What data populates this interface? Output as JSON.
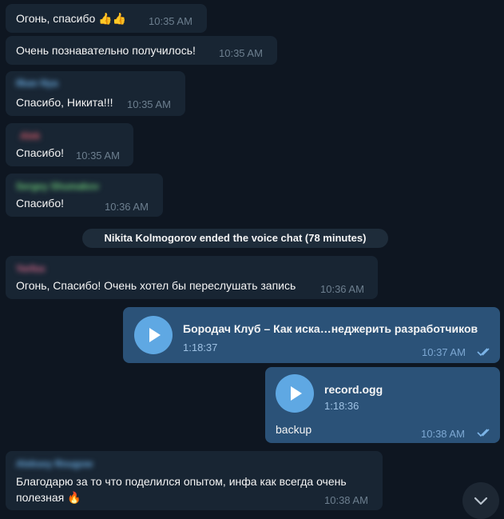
{
  "messages": [
    {
      "text": "Огонь, спасибо 👍👍",
      "time": "10:35 AM"
    },
    {
      "text": "Очень познавательно получилось!",
      "time": "10:35 AM"
    },
    {
      "sender": "Ilkan Nya",
      "sender_color": "#6fb2e8",
      "text": "Спасибо, Никита!!!",
      "time": "10:35 AM"
    },
    {
      "sender": "Alek",
      "sender_color": "#e05f6c",
      "text": "Спасибо!",
      "time": "10:35 AM"
    },
    {
      "sender": "Sergey Shumakov",
      "sender_color": "#6fcf7a",
      "text": "Спасибо!",
      "time": "10:36 AM"
    },
    {
      "sender": "Yerfox",
      "sender_color": "#e06c8f",
      "text": "Огонь, Спасибо! Очень хотел бы переслушать запись",
      "time": "10:36 AM"
    },
    {
      "sender": "Aleksey Rnugow",
      "sender_color": "#6fb2e8",
      "text_line1": "Благодарю за то что поделился опытом, инфа как всегда очень",
      "text_line2": "полезная 🔥",
      "time": "10:38 AM"
    }
  ],
  "service_message": "Nikita Kolmogorov ended the voice chat (78 minutes)",
  "audio1": {
    "title": "Бородач Клуб – Как иска…неджерить разработчиков",
    "duration": "1:18:37",
    "time": "10:37 AM"
  },
  "audio2": {
    "title": "record.ogg",
    "duration": "1:18:36",
    "caption": "backup",
    "time": "10:38 AM"
  },
  "icons": {
    "play": "play-icon",
    "read": "double-check-icon",
    "scroll": "chevron-down-icon"
  },
  "colors": {
    "background": "#0e1621",
    "incoming": "#182533",
    "outgoing": "#2b5278",
    "accent": "#5fa8e3"
  }
}
